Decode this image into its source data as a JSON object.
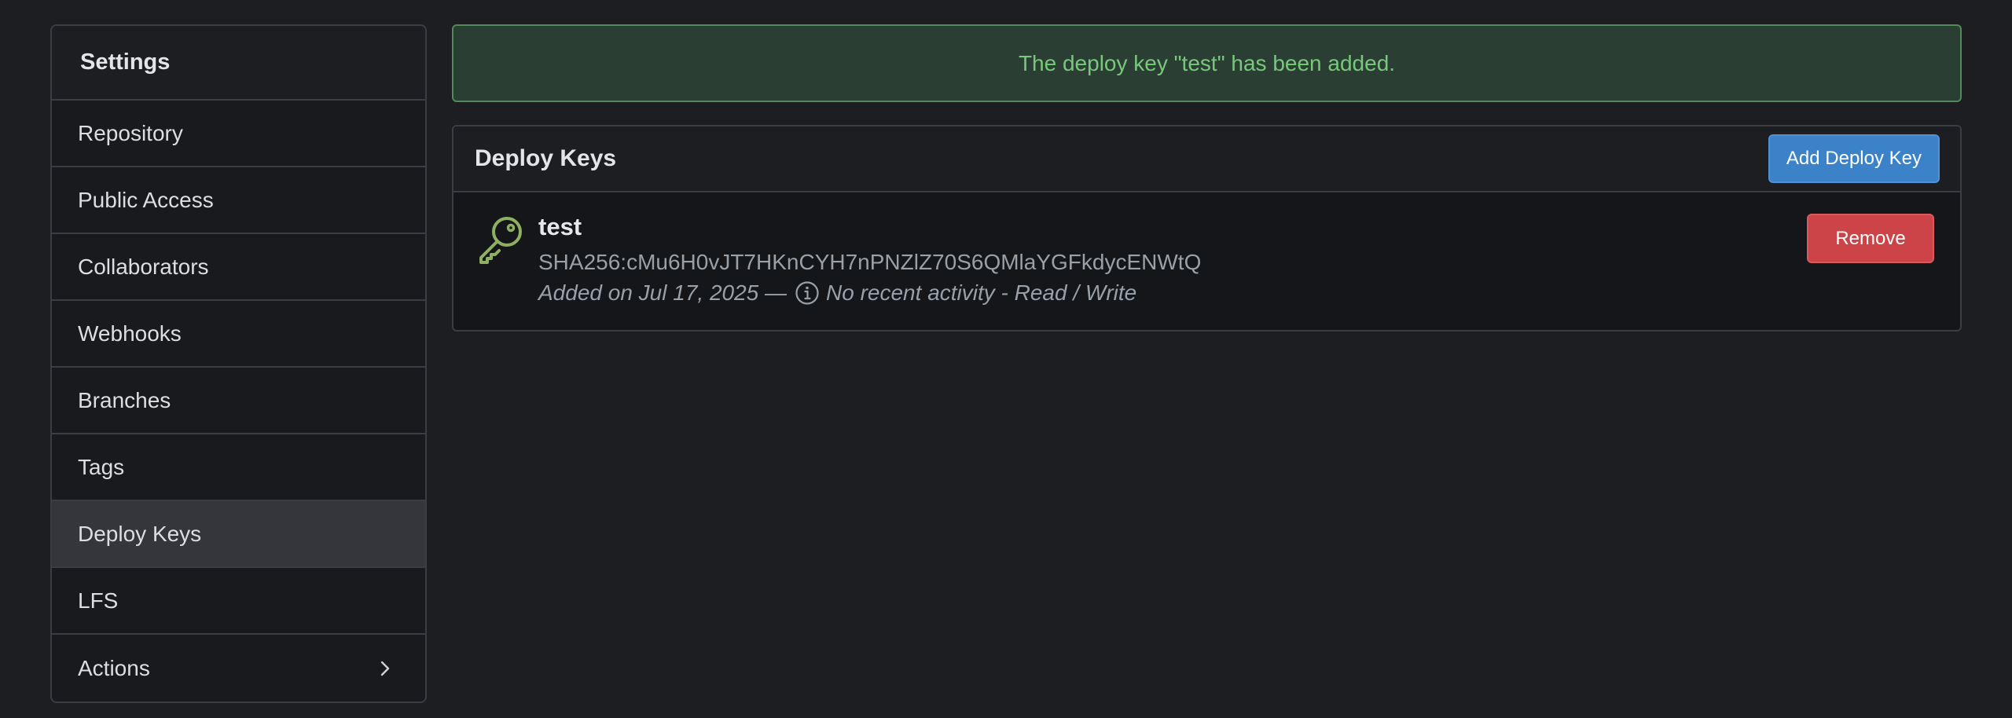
{
  "sidebar": {
    "title": "Settings",
    "items": [
      {
        "label": "Repository"
      },
      {
        "label": "Public Access"
      },
      {
        "label": "Collaborators"
      },
      {
        "label": "Webhooks"
      },
      {
        "label": "Branches"
      },
      {
        "label": "Tags"
      },
      {
        "label": "Deploy Keys",
        "active": true
      },
      {
        "label": "LFS"
      },
      {
        "label": "Actions",
        "icon": "chevron-right-icon"
      }
    ]
  },
  "flash": {
    "message": "The deploy key \"test\" has been added.",
    "color": "#78c87c"
  },
  "deploy_keys": {
    "title": "Deploy Keys",
    "add_button_label": "Add Deploy Key",
    "keys": [
      {
        "icon": "key-icon",
        "name": "test",
        "fingerprint": "SHA256:cMu6H0vJT7HKnCYH7nPNZlZ70S6QMlaYGFkdycENWtQ",
        "added": "Added on Jul 17, 2025 —",
        "activity": "No recent activity - Read / Write",
        "remove_label": "Remove"
      }
    ]
  },
  "colors": {
    "accent_blue": "#3b82c8",
    "danger_red": "#cc4448",
    "key_icon_green": "#8fb060"
  }
}
